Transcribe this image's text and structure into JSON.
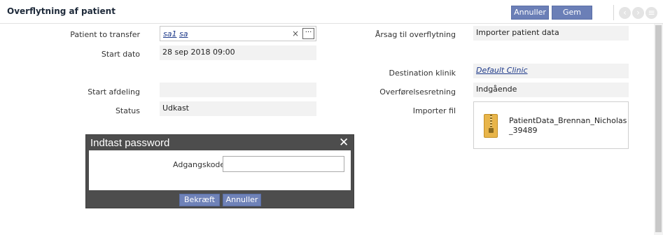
{
  "header": {
    "title": "Overflytning af patient",
    "cancel_label": "Annuller",
    "save_label": "Gem"
  },
  "form": {
    "patient_label": "Patient to transfer",
    "patient_first": "sa1",
    "patient_last": "sa",
    "clear_symbol": "×",
    "more_symbol": "···",
    "start_date_label": "Start dato",
    "start_date_value": "28 sep 2018 09:00",
    "start_department_label": "Start afdeling",
    "start_department_value": "",
    "status_label": "Status",
    "status_value": "Udkast",
    "reason_label": "Årsag til overflytning",
    "reason_value": "Importer patient data",
    "destination_label": "Destination klinik",
    "destination_value": "Default Clinic",
    "direction_label": "Overførelsesretning",
    "direction_value": "Indgående",
    "import_file_label": "Importer fil",
    "import_file_name": "PatientData_Brennan_Nicholas_39489"
  },
  "dialog": {
    "title": "Indtast password",
    "close_symbol": "✕",
    "password_label": "Adgangskode",
    "password_value": "",
    "confirm_label": "Bekræft",
    "cancel_label": "Annuller"
  },
  "nav": {
    "prev_icon": "chevron-left-icon",
    "next_icon": "chevron-right-icon",
    "menu_icon": "menu-icon"
  },
  "colors": {
    "button": "#6b7fb7",
    "field_bg": "#f2f2f2",
    "dialog_bg": "#4d4d4d",
    "link": "#1e3a8a"
  }
}
